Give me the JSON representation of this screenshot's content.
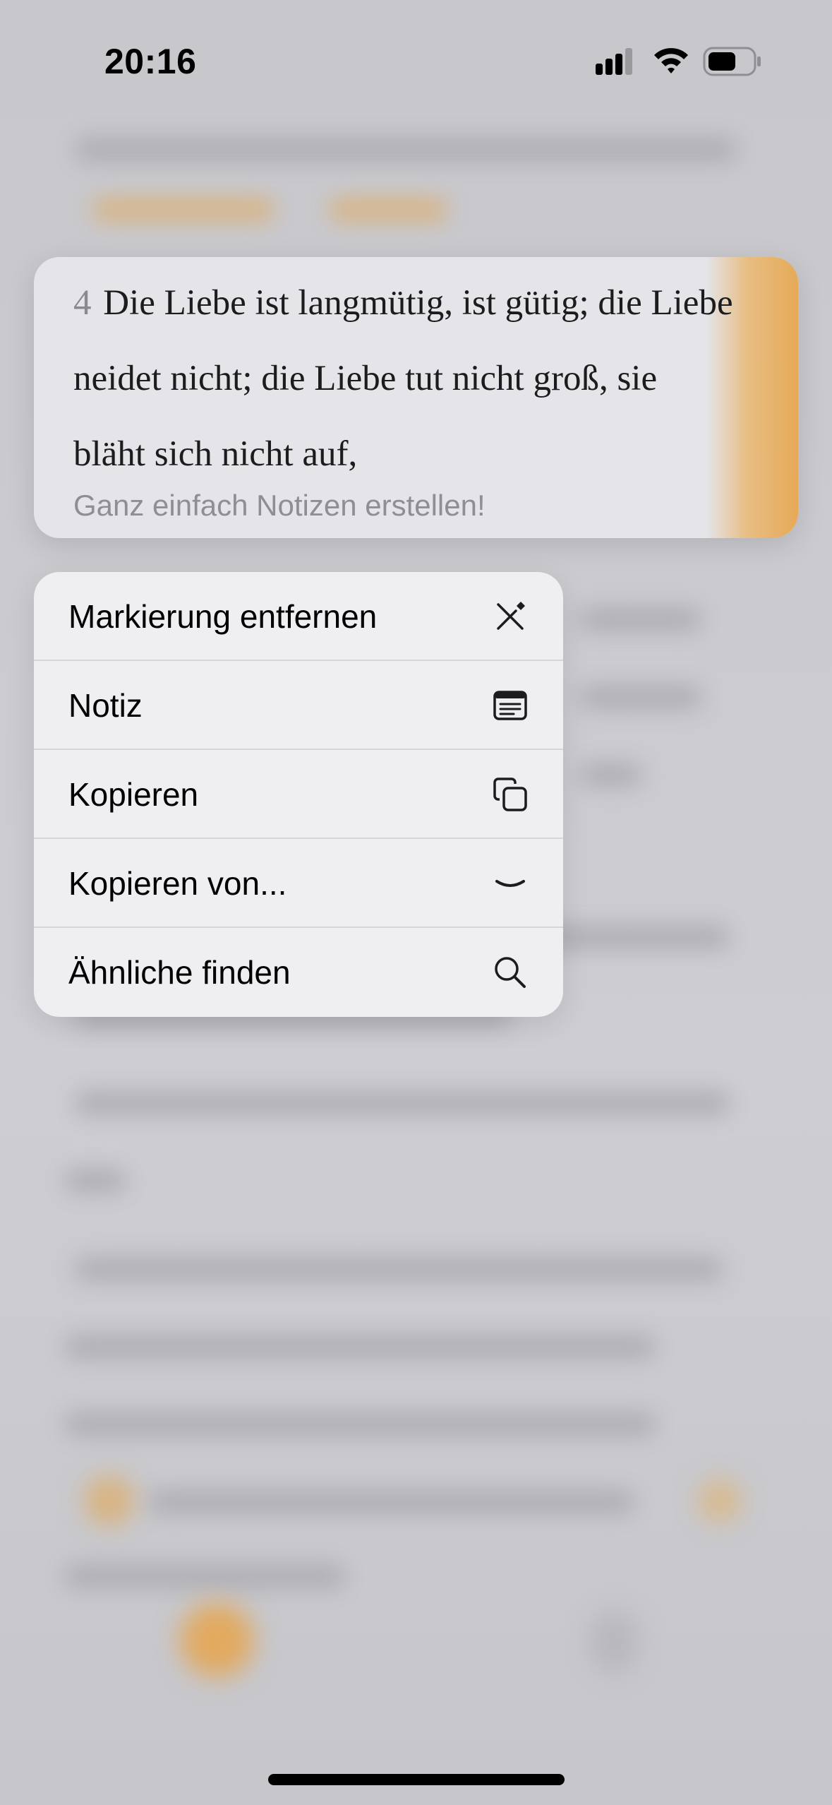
{
  "status_bar": {
    "time": "20:16",
    "icons": [
      "signal-icon",
      "wifi-icon",
      "battery-icon"
    ]
  },
  "verse_card": {
    "verse_number": "4",
    "lines": [
      "Die Liebe ist langmütig, ist gütig; die Liebe",
      "neidet nicht; die Liebe tut nicht groß, sie",
      "bläht sich nicht auf,"
    ],
    "hint": "Ganz einfach Notizen erstellen!",
    "highlight_color": "#e6aa58"
  },
  "context_menu": {
    "items": [
      {
        "label": "Markierung entfernen",
        "icon": "remove-highlight-icon"
      },
      {
        "label": "Notiz",
        "icon": "note-icon"
      },
      {
        "label": "Kopieren",
        "icon": "copy-icon"
      },
      {
        "label": "Kopieren von...",
        "icon": "chevron-down-icon"
      },
      {
        "label": "Ähnliche finden",
        "icon": "search-icon"
      }
    ]
  },
  "colors": {
    "background": "#c9c9ce",
    "menu_background": "#efeff2",
    "accent": "#e6aa58"
  }
}
